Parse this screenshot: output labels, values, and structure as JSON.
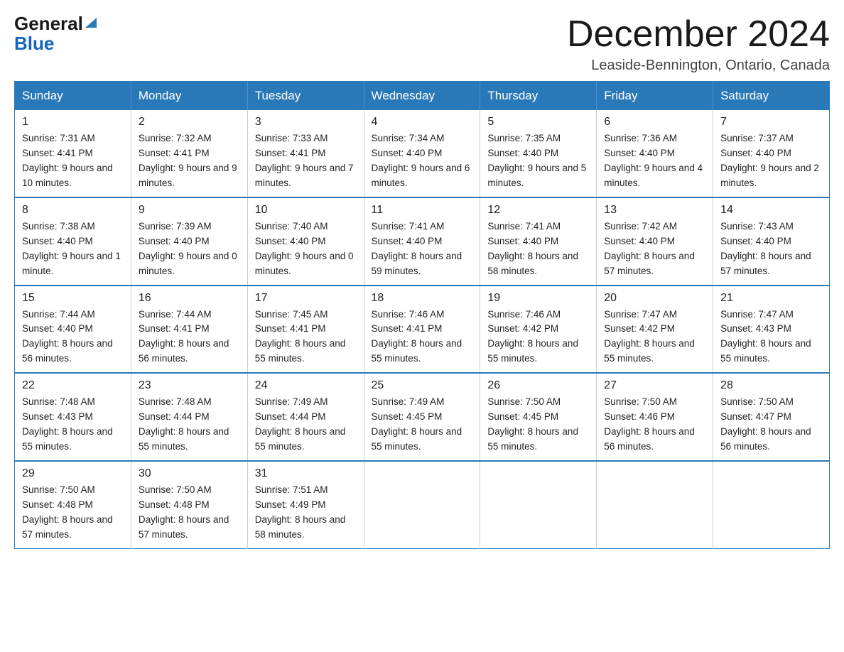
{
  "header": {
    "logo_general": "General",
    "logo_blue": "Blue",
    "month_title": "December 2024",
    "location": "Leaside-Bennington, Ontario, Canada"
  },
  "weekdays": [
    "Sunday",
    "Monday",
    "Tuesday",
    "Wednesday",
    "Thursday",
    "Friday",
    "Saturday"
  ],
  "weeks": [
    [
      {
        "day": "1",
        "sunrise": "7:31 AM",
        "sunset": "4:41 PM",
        "daylight": "9 hours and 10 minutes."
      },
      {
        "day": "2",
        "sunrise": "7:32 AM",
        "sunset": "4:41 PM",
        "daylight": "9 hours and 9 minutes."
      },
      {
        "day": "3",
        "sunrise": "7:33 AM",
        "sunset": "4:41 PM",
        "daylight": "9 hours and 7 minutes."
      },
      {
        "day": "4",
        "sunrise": "7:34 AM",
        "sunset": "4:40 PM",
        "daylight": "9 hours and 6 minutes."
      },
      {
        "day": "5",
        "sunrise": "7:35 AM",
        "sunset": "4:40 PM",
        "daylight": "9 hours and 5 minutes."
      },
      {
        "day": "6",
        "sunrise": "7:36 AM",
        "sunset": "4:40 PM",
        "daylight": "9 hours and 4 minutes."
      },
      {
        "day": "7",
        "sunrise": "7:37 AM",
        "sunset": "4:40 PM",
        "daylight": "9 hours and 2 minutes."
      }
    ],
    [
      {
        "day": "8",
        "sunrise": "7:38 AM",
        "sunset": "4:40 PM",
        "daylight": "9 hours and 1 minute."
      },
      {
        "day": "9",
        "sunrise": "7:39 AM",
        "sunset": "4:40 PM",
        "daylight": "9 hours and 0 minutes."
      },
      {
        "day": "10",
        "sunrise": "7:40 AM",
        "sunset": "4:40 PM",
        "daylight": "9 hours and 0 minutes."
      },
      {
        "day": "11",
        "sunrise": "7:41 AM",
        "sunset": "4:40 PM",
        "daylight": "8 hours and 59 minutes."
      },
      {
        "day": "12",
        "sunrise": "7:41 AM",
        "sunset": "4:40 PM",
        "daylight": "8 hours and 58 minutes."
      },
      {
        "day": "13",
        "sunrise": "7:42 AM",
        "sunset": "4:40 PM",
        "daylight": "8 hours and 57 minutes."
      },
      {
        "day": "14",
        "sunrise": "7:43 AM",
        "sunset": "4:40 PM",
        "daylight": "8 hours and 57 minutes."
      }
    ],
    [
      {
        "day": "15",
        "sunrise": "7:44 AM",
        "sunset": "4:40 PM",
        "daylight": "8 hours and 56 minutes."
      },
      {
        "day": "16",
        "sunrise": "7:44 AM",
        "sunset": "4:41 PM",
        "daylight": "8 hours and 56 minutes."
      },
      {
        "day": "17",
        "sunrise": "7:45 AM",
        "sunset": "4:41 PM",
        "daylight": "8 hours and 55 minutes."
      },
      {
        "day": "18",
        "sunrise": "7:46 AM",
        "sunset": "4:41 PM",
        "daylight": "8 hours and 55 minutes."
      },
      {
        "day": "19",
        "sunrise": "7:46 AM",
        "sunset": "4:42 PM",
        "daylight": "8 hours and 55 minutes."
      },
      {
        "day": "20",
        "sunrise": "7:47 AM",
        "sunset": "4:42 PM",
        "daylight": "8 hours and 55 minutes."
      },
      {
        "day": "21",
        "sunrise": "7:47 AM",
        "sunset": "4:43 PM",
        "daylight": "8 hours and 55 minutes."
      }
    ],
    [
      {
        "day": "22",
        "sunrise": "7:48 AM",
        "sunset": "4:43 PM",
        "daylight": "8 hours and 55 minutes."
      },
      {
        "day": "23",
        "sunrise": "7:48 AM",
        "sunset": "4:44 PM",
        "daylight": "8 hours and 55 minutes."
      },
      {
        "day": "24",
        "sunrise": "7:49 AM",
        "sunset": "4:44 PM",
        "daylight": "8 hours and 55 minutes."
      },
      {
        "day": "25",
        "sunrise": "7:49 AM",
        "sunset": "4:45 PM",
        "daylight": "8 hours and 55 minutes."
      },
      {
        "day": "26",
        "sunrise": "7:50 AM",
        "sunset": "4:45 PM",
        "daylight": "8 hours and 55 minutes."
      },
      {
        "day": "27",
        "sunrise": "7:50 AM",
        "sunset": "4:46 PM",
        "daylight": "8 hours and 56 minutes."
      },
      {
        "day": "28",
        "sunrise": "7:50 AM",
        "sunset": "4:47 PM",
        "daylight": "8 hours and 56 minutes."
      }
    ],
    [
      {
        "day": "29",
        "sunrise": "7:50 AM",
        "sunset": "4:48 PM",
        "daylight": "8 hours and 57 minutes."
      },
      {
        "day": "30",
        "sunrise": "7:50 AM",
        "sunset": "4:48 PM",
        "daylight": "8 hours and 57 minutes."
      },
      {
        "day": "31",
        "sunrise": "7:51 AM",
        "sunset": "4:49 PM",
        "daylight": "8 hours and 58 minutes."
      },
      null,
      null,
      null,
      null
    ]
  ],
  "labels": {
    "sunrise": "Sunrise:",
    "sunset": "Sunset:",
    "daylight": "Daylight:"
  }
}
